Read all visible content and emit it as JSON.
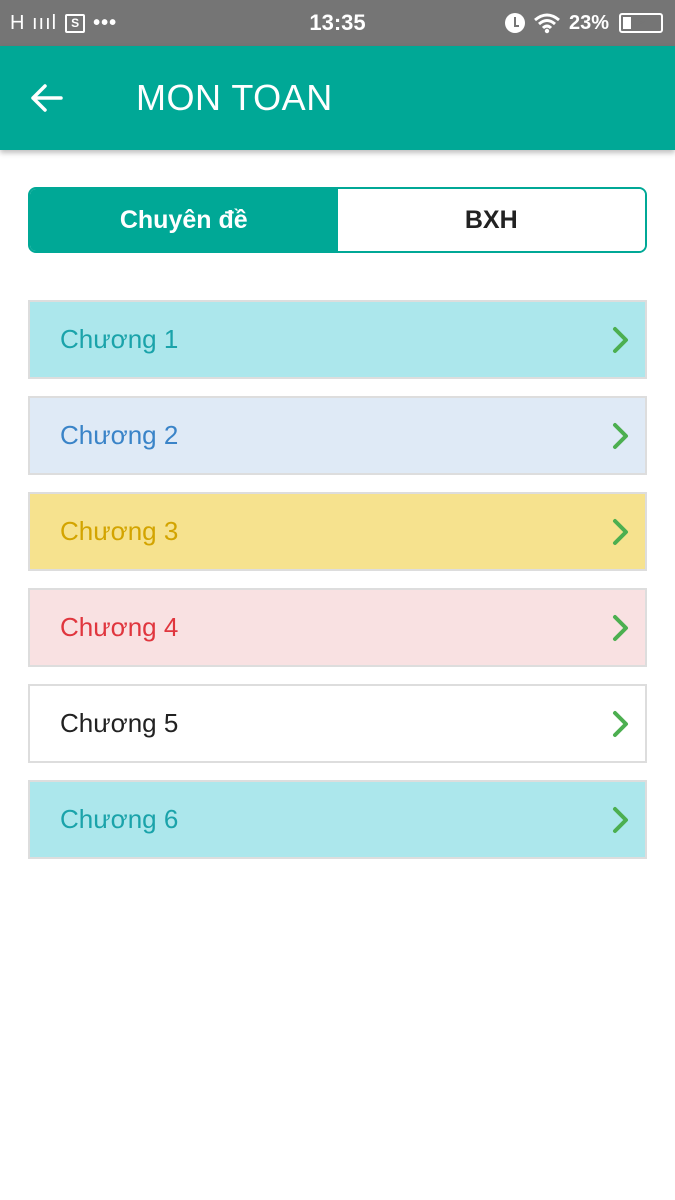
{
  "status_bar": {
    "network": "H ıııl",
    "sim_label": "S",
    "more": "•••",
    "time": "13:35",
    "wifi_icon": "wifi-icon",
    "battery_percent": "23%",
    "battery_level": 0.23,
    "battery_bolt": "⚡"
  },
  "app_bar": {
    "back_icon": "arrow-left-icon",
    "title": "MON TOAN"
  },
  "tabs": [
    {
      "label": "Chuyên đề",
      "active": true
    },
    {
      "label": "BXH",
      "active": false
    }
  ],
  "colors": {
    "primary": "#00a896",
    "chevron": "#4caf50"
  },
  "chapters": [
    {
      "label": "Chương 1",
      "bg": "#ace7ec",
      "text": "#1aa3aa"
    },
    {
      "label": "Chương 2",
      "bg": "#dfeaf6",
      "text": "#3a84c8"
    },
    {
      "label": "Chương 3",
      "bg": "#f6e28e",
      "text": "#d3a400"
    },
    {
      "label": "Chương 4",
      "bg": "#f9e1e2",
      "text": "#e0363e"
    },
    {
      "label": "Chương 5",
      "bg": "#ffffff",
      "text": "#222222"
    },
    {
      "label": "Chương 6",
      "bg": "#ace7ec",
      "text": "#1aa3aa"
    }
  ]
}
